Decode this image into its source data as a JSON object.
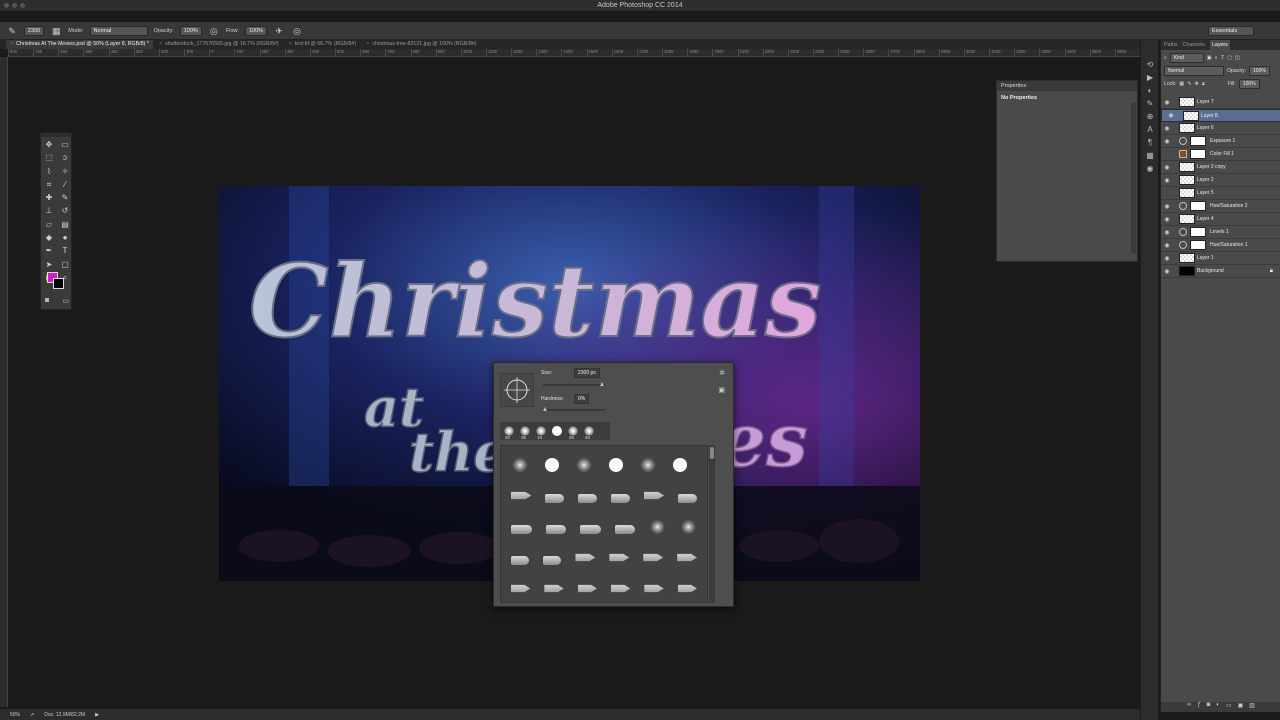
{
  "app": {
    "title": "Adobe Photoshop CC 2014"
  },
  "options_bar": {
    "brush_size": "2300",
    "mode_label": "Mode:",
    "mode_value": "Normal",
    "opacity_label": "Opacity:",
    "opacity_value": "100%",
    "flow_label": "Flow:",
    "flow_value": "100%",
    "workspace": "Essentials"
  },
  "tabs": [
    {
      "label": "Christmas At The Movies.psd @ 50% (Layer 8, RGB/8) *",
      "active": true
    },
    {
      "label": "shutterstock_177676565.jpg @ 16.7% (RGB/8#)",
      "active": false
    },
    {
      "label": "text.tif @ 66.7% (RGB/8#)",
      "active": false
    },
    {
      "label": "christmas-tree-83121.jpg @ 100% (RGB/8#)",
      "active": false
    }
  ],
  "ruler_marks": [
    "800",
    "700",
    "600",
    "500",
    "400",
    "300",
    "200",
    "100",
    "0",
    "100",
    "200",
    "300",
    "400",
    "500",
    "600",
    "700",
    "800",
    "900",
    "1000",
    "1100",
    "1200",
    "1300",
    "1400",
    "1500",
    "1600",
    "1700",
    "1800",
    "1900",
    "2000",
    "2100",
    "2200",
    "2300",
    "2400",
    "2500",
    "2600",
    "2700",
    "2800",
    "2900",
    "3000",
    "3100",
    "3200",
    "3300",
    "3400",
    "3500",
    "3600"
  ],
  "tools": [
    "move-icon",
    "artboard-icon",
    "marquee-icon",
    "lasso-icon",
    "lasso-poly-icon",
    "magic-wand-icon",
    "crop-icon",
    "eyedropper-icon",
    "healing-icon",
    "brush-icon",
    "stamp-icon",
    "history-brush-icon",
    "eraser-icon",
    "gradient-icon",
    "blur-icon",
    "dodge-icon",
    "pen-icon",
    "type-icon",
    "path-select-icon",
    "shape-icon",
    "hand-icon",
    "zoom-icon"
  ],
  "colors": {
    "foreground": "#d01ccc",
    "background": "#000000",
    "selected_layer": "#5a6e93"
  },
  "brush_picker": {
    "size_label": "Size:",
    "size_value": "2300 px",
    "hardness_label": "Hardness:",
    "hardness_value": "0%",
    "size_fraction": 0.95,
    "hardness_fraction": 0,
    "recent_sizes": [
      "20",
      "35",
      "15",
      "",
      "25",
      "45"
    ],
    "preset_numbers": [
      "25",
      "50",
      "25",
      "50"
    ]
  },
  "properties": {
    "title": "Properties",
    "body": "No Properties"
  },
  "layers_panel": {
    "tabs": [
      "Paths",
      "Channels",
      "Layers"
    ],
    "filter": "Kind",
    "blend_mode": "Normal",
    "opacity_label": "Opacity:",
    "opacity_value": "100%",
    "lock_label": "Lock:",
    "fill_label": "Fill:",
    "fill_value": "100%",
    "layers": [
      {
        "name": "Layer 7",
        "type": "pixel",
        "visible": true,
        "selected": false
      },
      {
        "name": "Layer 8",
        "type": "pixel",
        "visible": true,
        "selected": true
      },
      {
        "name": "Layer 6",
        "type": "pixel",
        "visible": true,
        "selected": false
      },
      {
        "name": "Exposure 1",
        "type": "adjustment",
        "visible": true,
        "selected": false
      },
      {
        "name": "Color Fill 1",
        "type": "fill",
        "visible": false,
        "selected": false
      },
      {
        "name": "Layer 2 copy",
        "type": "pixel",
        "visible": true,
        "selected": false
      },
      {
        "name": "Layer 2",
        "type": "pixel",
        "visible": true,
        "selected": false
      },
      {
        "name": "Layer 5",
        "type": "pixel",
        "visible": false,
        "selected": false
      },
      {
        "name": "Hue/Saturation 2",
        "type": "adjustment",
        "visible": true,
        "selected": false
      },
      {
        "name": "Layer 4",
        "type": "pixel",
        "visible": true,
        "selected": false
      },
      {
        "name": "Levels 1",
        "type": "adjustment",
        "visible": true,
        "selected": false
      },
      {
        "name": "Hue/Saturation 1",
        "type": "adjustment",
        "visible": true,
        "selected": false
      },
      {
        "name": "Layer 1",
        "type": "pixel",
        "visible": true,
        "selected": false
      },
      {
        "name": "Background",
        "type": "background",
        "visible": true,
        "selected": false
      }
    ]
  },
  "canvas": {
    "line1": "Christmas",
    "line2": "at",
    "line3": "the",
    "line4": "es"
  },
  "status": {
    "zoom": "50%",
    "doc": "Doc: 12.9M/82.2M"
  }
}
